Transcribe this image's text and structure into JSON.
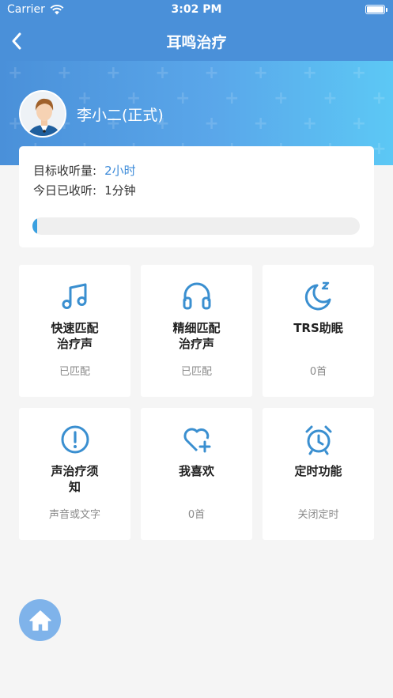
{
  "status_bar": {
    "carrier": "Carrier",
    "time": "3:02 PM"
  },
  "nav": {
    "title": "耳鸣治疗"
  },
  "user": {
    "name": "李小二(正式)"
  },
  "listening": {
    "target_label": "目标收听量:",
    "target_value": "2小时",
    "today_label": "今日已收听:",
    "today_value": "1分钟",
    "progress_fraction": 0.008
  },
  "tiles": [
    {
      "label": "快速匹配\n治疗声",
      "status": "已匹配",
      "icon": "music-note-icon"
    },
    {
      "label": "精细匹配\n治疗声",
      "status": "已匹配",
      "icon": "headphones-icon"
    },
    {
      "label": "TRS助眠",
      "status": "0首",
      "icon": "moon-sleep-icon"
    },
    {
      "label": "声治疗须\n知",
      "status": "声音或文字",
      "icon": "exclamation-circle-icon"
    },
    {
      "label": "我喜欢",
      "status": "0首",
      "icon": "heart-plus-icon"
    },
    {
      "label": "定时功能",
      "status": "关闭定时",
      "icon": "alarm-clock-icon"
    }
  ],
  "colors": {
    "header": "#4a90d9",
    "accent": "#3d8bd9",
    "icon": "#3a8fd0",
    "fab": "#7fb3ea"
  }
}
